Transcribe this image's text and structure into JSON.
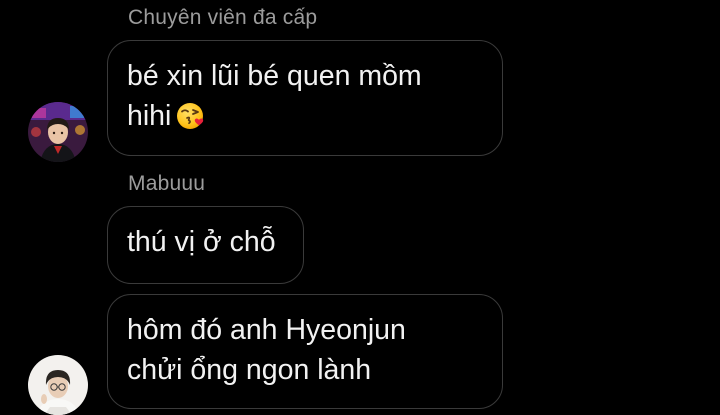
{
  "messages": {
    "group1": {
      "sender": "Chuyên viên đa cấp",
      "bubble1": {
        "line1": "bé xin lũi bé quen mồm",
        "line2": "hihi",
        "emoji": "face-blowing-kiss-icon"
      }
    },
    "group2": {
      "sender": "Mabuuu",
      "bubble1": {
        "line1": "thú vị ở chỗ"
      },
      "bubble2": {
        "line1": "hôm đó anh Hyeonjun",
        "line2": "chửi ổng ngon lành"
      }
    }
  },
  "colors": {
    "background": "#000000",
    "bubble_border": "#3a3a3a",
    "message_text": "#f2f2f2",
    "sender_text": "#9c9c9c"
  }
}
